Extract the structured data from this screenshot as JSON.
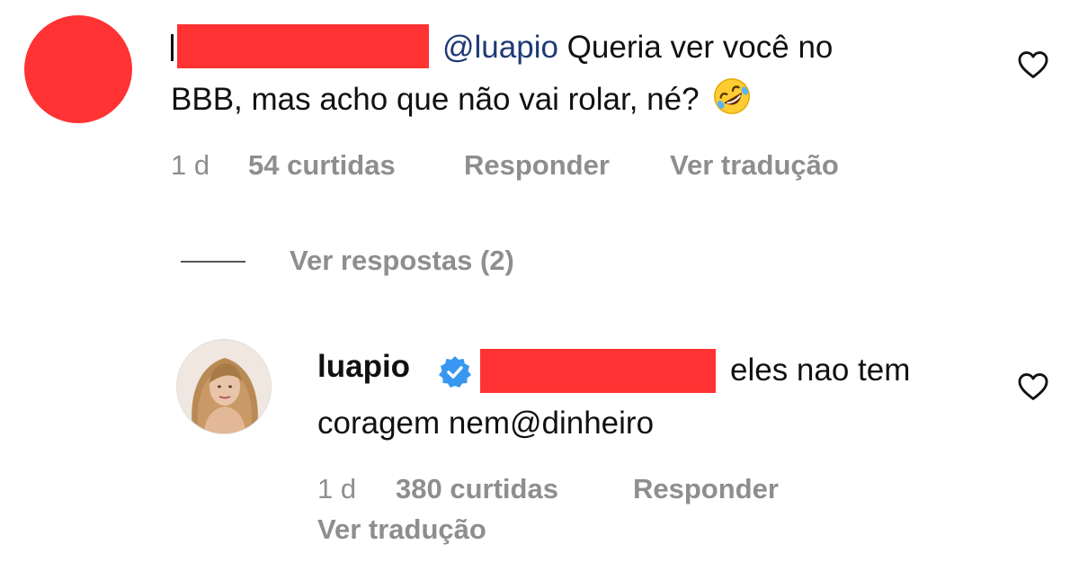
{
  "comment": {
    "mention": "@luapio",
    "text_line1": " Queria ver você no",
    "text_line2": "BBB, mas acho que não vai rolar, né?",
    "emoji_icon": "rolling-on-floor-laughing-emoji",
    "time": "1 d",
    "likes": "54 curtidas",
    "reply_label": "Responder",
    "translate_label": "Ver tradução",
    "like_icon": "heart-outline-icon",
    "redaction_color": "#ff3333"
  },
  "replies_toggle": {
    "label": "Ver respostas (2)"
  },
  "reply": {
    "username": "luapio",
    "verified_icon": "verified-badge-icon",
    "verified_color": "#3897f0",
    "text_line1": "eles nao tem",
    "text_line2": "coragem nem@dinheiro",
    "time": "1 d",
    "likes": "380 curtidas",
    "reply_label": "Responder",
    "translate_label": "Ver tradução",
    "like_icon": "heart-outline-icon"
  },
  "colors": {
    "mention": "#1f3a74",
    "meta_text": "#8e8e8e",
    "text": "#111111"
  }
}
